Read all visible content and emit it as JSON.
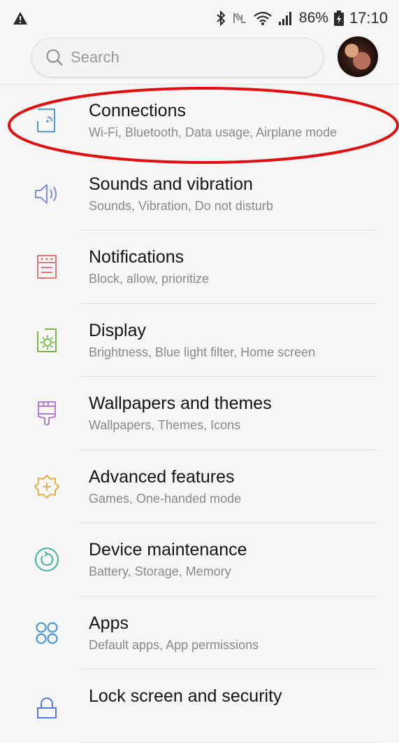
{
  "status_bar": {
    "battery": "86%",
    "time": "17:10",
    "icons": [
      "warning-icon",
      "bluetooth-icon",
      "nfc-icon",
      "wifi-icon",
      "signal-icon",
      "battery-icon"
    ]
  },
  "search": {
    "placeholder": "Search"
  },
  "settings": {
    "items": [
      {
        "title": "Connections",
        "subtitle": "Wi-Fi, Bluetooth, Data usage, Airplane mode",
        "icon": "connections-icon",
        "color": "#5b9bd5"
      },
      {
        "title": "Sounds and vibration",
        "subtitle": "Sounds, Vibration, Do not disturb",
        "icon": "sound-icon",
        "color": "#7d8fd6"
      },
      {
        "title": "Notifications",
        "subtitle": "Block, allow, prioritize",
        "icon": "notifications-icon",
        "color": "#e07a7a"
      },
      {
        "title": "Display",
        "subtitle": "Brightness, Blue light filter, Home screen",
        "icon": "display-icon",
        "color": "#7ab648"
      },
      {
        "title": "Wallpapers and themes",
        "subtitle": "Wallpapers, Themes, Icons",
        "icon": "wallpaper-icon",
        "color": "#b37bd1"
      },
      {
        "title": "Advanced features",
        "subtitle": "Games, One-handed mode",
        "icon": "advanced-features-icon",
        "color": "#e8b04a"
      },
      {
        "title": "Device maintenance",
        "subtitle": "Battery, Storage, Memory",
        "icon": "device-maintenance-icon",
        "color": "#3fb59a"
      },
      {
        "title": "Apps",
        "subtitle": "Default apps, App permissions",
        "icon": "apps-icon",
        "color": "#3a8fd8"
      },
      {
        "title": "Lock screen and security",
        "subtitle": "",
        "icon": "lock-icon",
        "color": "#5b7ad5"
      }
    ]
  },
  "annotation_color": "#e01010"
}
